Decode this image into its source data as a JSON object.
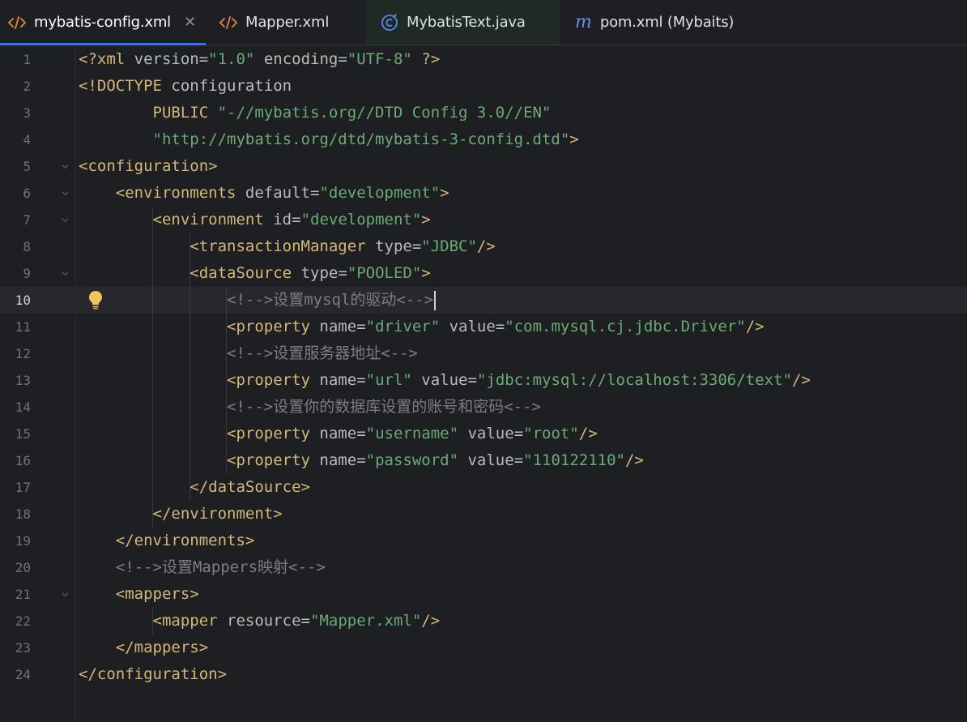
{
  "tabs": [
    {
      "label": "mybatis-config.xml",
      "icon": "xml-icon",
      "active": true,
      "closable": true
    },
    {
      "label": "Mapper.xml",
      "icon": "xml-icon",
      "active": false
    },
    {
      "label": "MybatisText.java",
      "icon": "java-class-icon",
      "active": false
    },
    {
      "label": "pom.xml (Mybaits)",
      "icon": "maven-icon",
      "active": false
    }
  ],
  "colors": {
    "tag": "#d5b778",
    "attribute": "#bababa",
    "string": "#6aab73",
    "comment": "#7a7e85",
    "accent": "#3574f0",
    "background": "#1e1f22"
  },
  "editor": {
    "current_line": 10,
    "lines": [
      {
        "n": "1",
        "segs": [
          [
            "tag",
            "<?xml "
          ],
          [
            "attr",
            "version"
          ],
          [
            "plain",
            "="
          ],
          [
            "str",
            "\"1.0\""
          ],
          [
            "plain",
            " "
          ],
          [
            "attr",
            "encoding"
          ],
          [
            "plain",
            "="
          ],
          [
            "str",
            "\"UTF-8\""
          ],
          [
            "tag",
            " ?>"
          ]
        ]
      },
      {
        "n": "2",
        "segs": [
          [
            "tag",
            "<!DOCTYPE "
          ],
          [
            "plain",
            "configuration"
          ]
        ]
      },
      {
        "n": "3",
        "segs": [
          [
            "plain",
            "        "
          ],
          [
            "tag",
            "PUBLIC "
          ],
          [
            "str",
            "\"-//mybatis.org//DTD Config 3.0//EN\""
          ]
        ]
      },
      {
        "n": "4",
        "segs": [
          [
            "plain",
            "        "
          ],
          [
            "str",
            "\"http://mybatis.org/dtd/mybatis-3-config.dtd\""
          ],
          [
            "tag",
            ">"
          ]
        ]
      },
      {
        "n": "5",
        "segs": [
          [
            "tag",
            "<configuration>"
          ]
        ]
      },
      {
        "n": "6",
        "segs": [
          [
            "plain",
            "    "
          ],
          [
            "tag",
            "<environments "
          ],
          [
            "attr",
            "default"
          ],
          [
            "plain",
            "="
          ],
          [
            "str",
            "\"development\""
          ],
          [
            "tag",
            ">"
          ]
        ]
      },
      {
        "n": "7",
        "segs": [
          [
            "plain",
            "        "
          ],
          [
            "tag",
            "<environment "
          ],
          [
            "attr",
            "id"
          ],
          [
            "plain",
            "="
          ],
          [
            "str",
            "\"development\""
          ],
          [
            "tag",
            ">"
          ]
        ]
      },
      {
        "n": "8",
        "segs": [
          [
            "plain",
            "            "
          ],
          [
            "tag",
            "<transactionManager "
          ],
          [
            "attr",
            "type"
          ],
          [
            "plain",
            "="
          ],
          [
            "str",
            "\"JDBC\""
          ],
          [
            "tag",
            "/>"
          ]
        ]
      },
      {
        "n": "9",
        "segs": [
          [
            "plain",
            "            "
          ],
          [
            "tag",
            "<dataSource "
          ],
          [
            "attr",
            "type"
          ],
          [
            "plain",
            "="
          ],
          [
            "str",
            "\"POOLED\""
          ],
          [
            "tag",
            ">"
          ]
        ]
      },
      {
        "n": "10",
        "segs": [
          [
            "plain",
            "                "
          ],
          [
            "cmt",
            "<!-->设置mysql的驱动<-->"
          ]
        ]
      },
      {
        "n": "11",
        "segs": [
          [
            "plain",
            "                "
          ],
          [
            "tag",
            "<property "
          ],
          [
            "attr",
            "name"
          ],
          [
            "plain",
            "="
          ],
          [
            "str",
            "\"driver\""
          ],
          [
            "plain",
            " "
          ],
          [
            "attr",
            "value"
          ],
          [
            "plain",
            "="
          ],
          [
            "str",
            "\"com.mysql.cj.jdbc.Driver\""
          ],
          [
            "tag",
            "/>"
          ]
        ]
      },
      {
        "n": "12",
        "segs": [
          [
            "plain",
            "                "
          ],
          [
            "cmt",
            "<!-->设置服务器地址<-->"
          ]
        ]
      },
      {
        "n": "13",
        "segs": [
          [
            "plain",
            "                "
          ],
          [
            "tag",
            "<property "
          ],
          [
            "attr",
            "name"
          ],
          [
            "plain",
            "="
          ],
          [
            "str",
            "\"url\""
          ],
          [
            "plain",
            " "
          ],
          [
            "attr",
            "value"
          ],
          [
            "plain",
            "="
          ],
          [
            "str",
            "\"jdbc:mysql://localhost:3306/text\""
          ],
          [
            "tag",
            "/>"
          ]
        ]
      },
      {
        "n": "14",
        "segs": [
          [
            "plain",
            "                "
          ],
          [
            "cmt",
            "<!-->设置你的数据库设置的账号和密码<-->"
          ]
        ]
      },
      {
        "n": "15",
        "segs": [
          [
            "plain",
            "                "
          ],
          [
            "tag",
            "<property "
          ],
          [
            "attr",
            "name"
          ],
          [
            "plain",
            "="
          ],
          [
            "str",
            "\"username\""
          ],
          [
            "plain",
            " "
          ],
          [
            "attr",
            "value"
          ],
          [
            "plain",
            "="
          ],
          [
            "str",
            "\"root\""
          ],
          [
            "tag",
            "/>"
          ]
        ]
      },
      {
        "n": "16",
        "segs": [
          [
            "plain",
            "                "
          ],
          [
            "tag",
            "<property "
          ],
          [
            "attr",
            "name"
          ],
          [
            "plain",
            "="
          ],
          [
            "str",
            "\"password\""
          ],
          [
            "plain",
            " "
          ],
          [
            "attr",
            "value"
          ],
          [
            "plain",
            "="
          ],
          [
            "str",
            "\"110122110\""
          ],
          [
            "tag",
            "/>"
          ]
        ]
      },
      {
        "n": "17",
        "segs": [
          [
            "plain",
            "            "
          ],
          [
            "tag",
            "</dataSource>"
          ]
        ]
      },
      {
        "n": "18",
        "segs": [
          [
            "plain",
            "        "
          ],
          [
            "tag",
            "</environment>"
          ]
        ]
      },
      {
        "n": "19",
        "segs": [
          [
            "plain",
            "    "
          ],
          [
            "tag",
            "</environments>"
          ]
        ]
      },
      {
        "n": "20",
        "segs": [
          [
            "plain",
            "    "
          ],
          [
            "cmt",
            "<!-->设置Mappers映射<-->"
          ]
        ]
      },
      {
        "n": "21",
        "segs": [
          [
            "plain",
            "    "
          ],
          [
            "tag",
            "<mappers>"
          ]
        ]
      },
      {
        "n": "22",
        "segs": [
          [
            "plain",
            "        "
          ],
          [
            "tag",
            "<mapper "
          ],
          [
            "attr",
            "resource"
          ],
          [
            "plain",
            "="
          ],
          [
            "str",
            "\"Mapper.xml\""
          ],
          [
            "tag",
            "/>"
          ]
        ]
      },
      {
        "n": "23",
        "segs": [
          [
            "plain",
            "    "
          ],
          [
            "tag",
            "</mappers>"
          ]
        ]
      },
      {
        "n": "24",
        "segs": [
          [
            "tag",
            "</configuration>"
          ]
        ]
      }
    ]
  }
}
